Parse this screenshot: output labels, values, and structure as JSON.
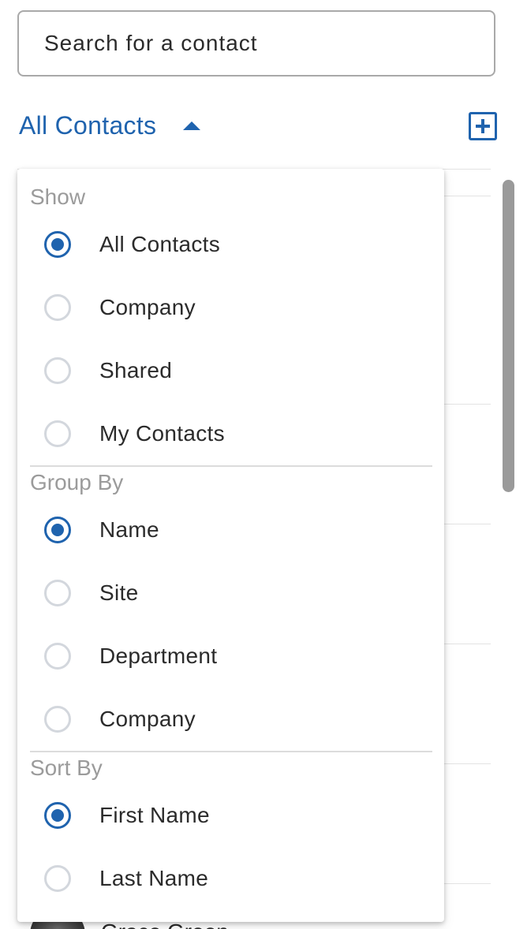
{
  "search": {
    "placeholder": "Search for a contact",
    "value": ""
  },
  "filter": {
    "label": "All Contacts",
    "expanded": true
  },
  "add_contact": {
    "icon": "plus-square-icon"
  },
  "list": {
    "partial_contact_name": "Grace Green"
  },
  "dropdown": {
    "show": {
      "title": "Show",
      "options": [
        {
          "label": "All Contacts",
          "checked": true
        },
        {
          "label": "Company",
          "checked": false
        },
        {
          "label": "Shared",
          "checked": false
        },
        {
          "label": "My Contacts",
          "checked": false
        }
      ]
    },
    "group_by": {
      "title": "Group By",
      "options": [
        {
          "label": "Name",
          "checked": true
        },
        {
          "label": "Site",
          "checked": false
        },
        {
          "label": "Department",
          "checked": false
        },
        {
          "label": "Company",
          "checked": false
        }
      ]
    },
    "sort_by": {
      "title": "Sort By",
      "options": [
        {
          "label": "First Name",
          "checked": true
        },
        {
          "label": "Last Name",
          "checked": false
        }
      ]
    }
  },
  "colors": {
    "accent": "#1f63ae",
    "text": "#2b2b2b",
    "muted": "#9b9b9b",
    "radio_border": "#d3d7dd"
  }
}
